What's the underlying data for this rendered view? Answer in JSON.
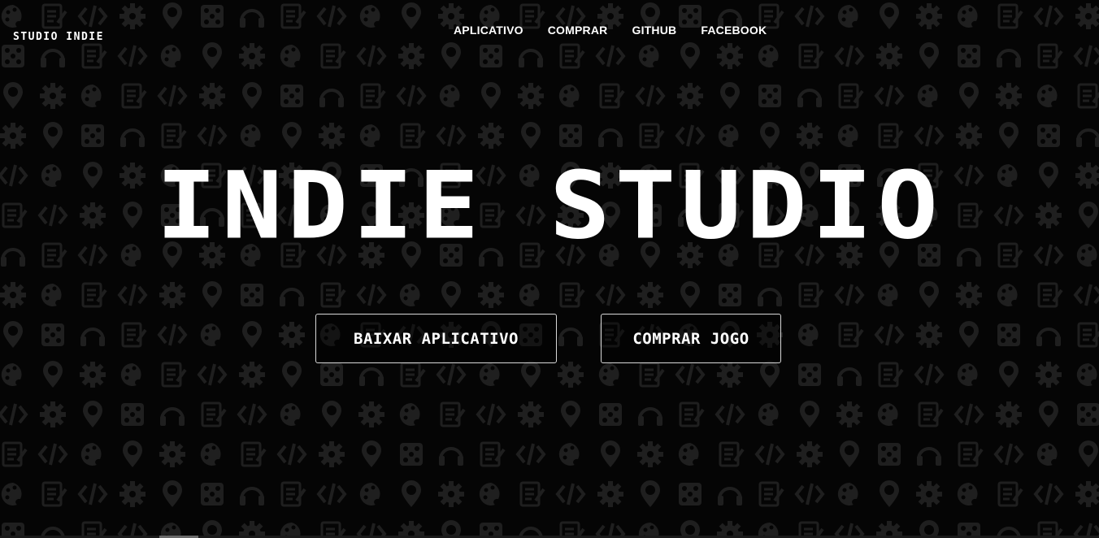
{
  "header": {
    "logo": "STUDIO INDIE",
    "nav": [
      {
        "label": "APLICATIVO"
      },
      {
        "label": "COMPRAR"
      },
      {
        "label": "GITHUB"
      },
      {
        "label": "FACEBOOK"
      }
    ]
  },
  "hero": {
    "title": "INDIE STUDIO",
    "buttons": {
      "download": "BAIXAR APLICATIVO",
      "buy": "COMPRAR JOGO"
    }
  },
  "theme": {
    "background": "#050505",
    "pattern_color": "#1f1f1f",
    "text": "#ffffff",
    "border": "#d8d8d8"
  },
  "background_icons": [
    "coin-icon",
    "gear-icon",
    "code-icon",
    "notepad-icon",
    "headphones-icon",
    "map-pin-icon",
    "dice-icon",
    "palette-icon",
    "pencil-icon"
  ]
}
